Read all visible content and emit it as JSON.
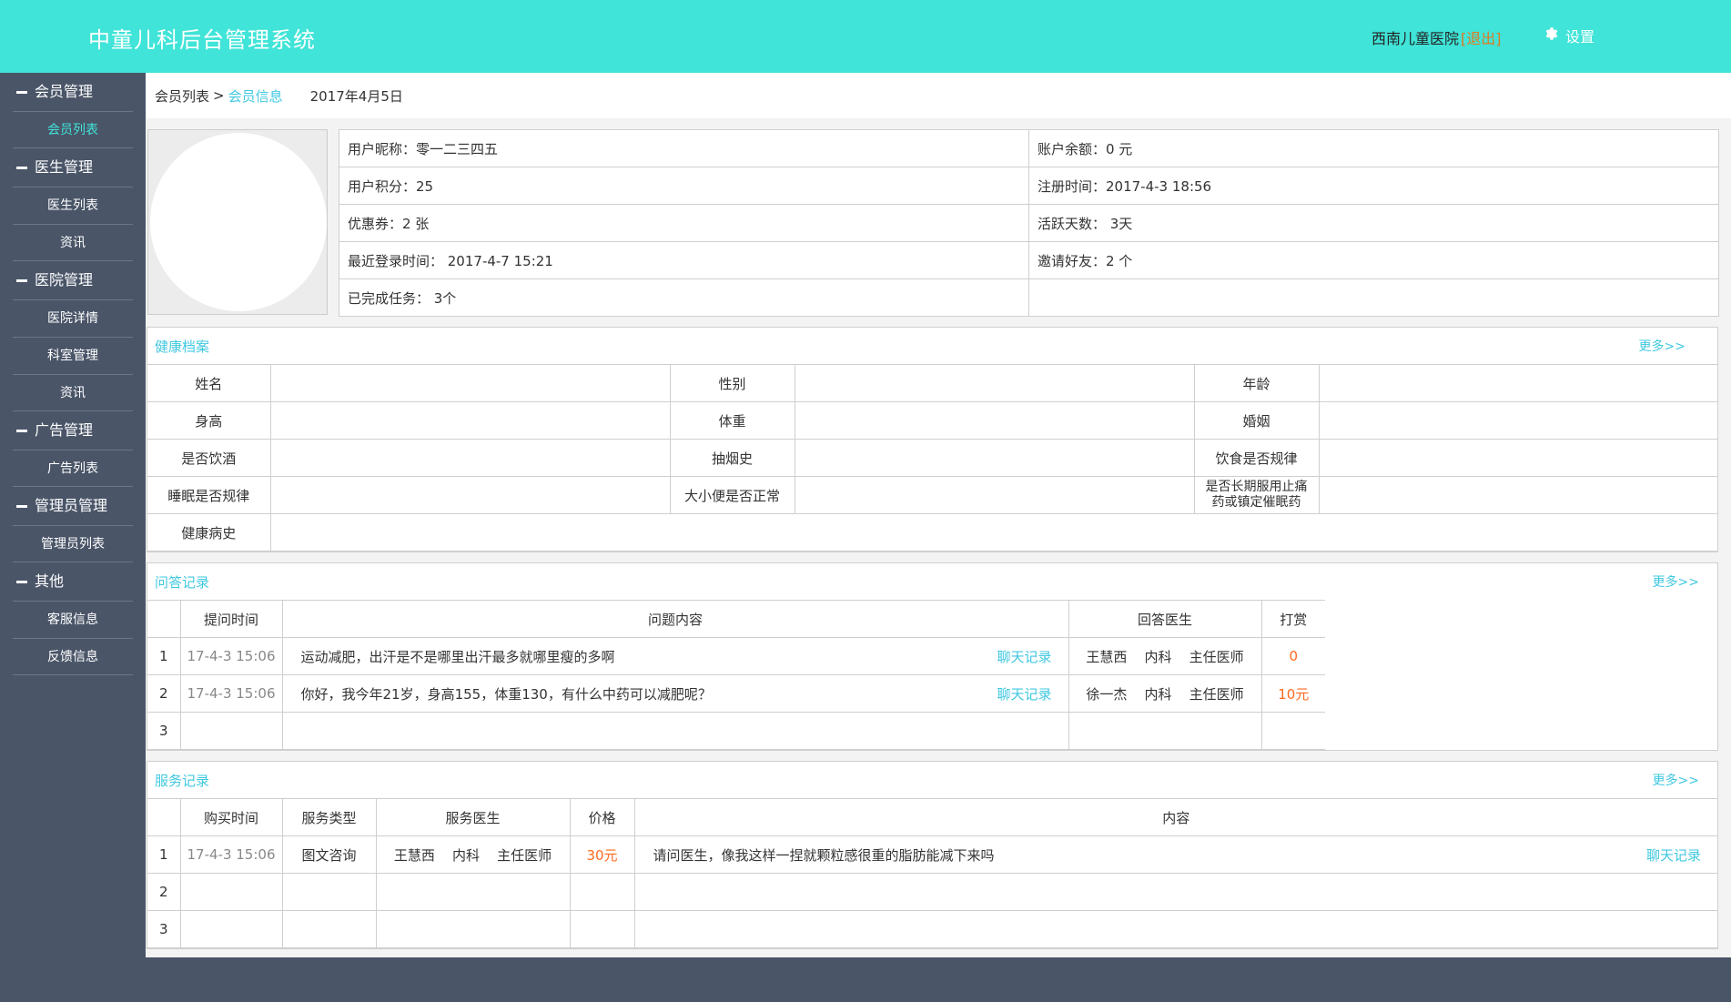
{
  "header": {
    "title": "中童儿科后台管理系统",
    "hospital": "西南儿童医院",
    "logout": "[退出]",
    "settings": "设置",
    "bg_color": "#40e4d8"
  },
  "sidebar": {
    "groups": [
      {
        "label": "会员管理",
        "items": [
          "会员列表"
        ]
      },
      {
        "label": "医生管理",
        "items": [
          "医生列表",
          "资讯"
        ]
      },
      {
        "label": "医院管理",
        "items": [
          "医院详情",
          "科室管理",
          "资讯"
        ]
      },
      {
        "label": "广告管理",
        "items": [
          "广告列表"
        ]
      },
      {
        "label": "管理员管理",
        "items": [
          "管理员列表"
        ]
      },
      {
        "label": "其他",
        "items": [
          "客服信息",
          "反馈信息"
        ]
      }
    ]
  },
  "breadcrumb": {
    "parent": "会员列表",
    "sep": ">",
    "current": "会员信息",
    "date": "2017年4月5日"
  },
  "profile": {
    "nickname": "用户昵称：零一二三四五",
    "balance": "账户余额：0 元",
    "points": "用户积分：25",
    "registered": "注册时间：2017-4-3   18:56",
    "coupons": "优惠券：2 张",
    "active_days": "活跃天数：  3天",
    "last_login": "最近登录时间：  2017-4-7   15:21",
    "invites": "邀请好友：2 个",
    "tasks": "已完成任务：  3个"
  },
  "health": {
    "title": "健康档案",
    "more": "更多>>",
    "labels": {
      "name": "姓名",
      "gender": "性别",
      "age": "年龄",
      "height": "身高",
      "weight": "体重",
      "marriage": "婚姻",
      "drink": "是否饮酒",
      "smoke": "抽烟史",
      "diet": "饮食是否规律",
      "sleep": "睡眠是否规律",
      "bowel": "大小便是否正常",
      "drug_line1": "是否长期服用止痛",
      "drug_line2": "药或镇定催眠药",
      "history": "健康病史"
    }
  },
  "qa": {
    "title": "问答记录",
    "more": "更多>>",
    "headers": {
      "time": "提问时间",
      "content": "问题内容",
      "doctor": "回答医生",
      "reward": "打赏"
    },
    "rows": [
      {
        "no": "1",
        "time": "17-4-3  15:06",
        "content": "运动减肥，出汗是不是哪里出汗最多就哪里瘦的多啊",
        "chat": "聊天记录",
        "doctor": "王慧西    内科    主任医师",
        "reward": "0"
      },
      {
        "no": "2",
        "time": "17-4-3  15:06",
        "content": "你好，我今年21岁，身高155，体重130，有什么中药可以减肥呢？",
        "chat": "聊天记录",
        "doctor": "徐一杰    内科    主任医师",
        "reward": "10元"
      },
      {
        "no": "3",
        "time": "",
        "content": "",
        "chat": "",
        "doctor": "",
        "reward": ""
      }
    ]
  },
  "services": {
    "title": "服务记录",
    "more": "更多>>",
    "headers": {
      "time": "购买时间",
      "type": "服务类型",
      "doctor": "服务医生",
      "price": "价格",
      "content": "内容"
    },
    "rows": [
      {
        "no": "1",
        "time": "17-4-3  15:06",
        "type": "图文咨询",
        "doctor": "王慧西    内科    主任医师",
        "price": "30元",
        "content": "请问医生，像我这样一捏就颗粒感很重的脂肪能减下来吗",
        "chat": "聊天记录"
      },
      {
        "no": "2",
        "time": "",
        "type": "",
        "doctor": "",
        "price": "",
        "content": "",
        "chat": ""
      },
      {
        "no": "3",
        "time": "",
        "type": "",
        "doctor": "",
        "price": "",
        "content": "",
        "chat": ""
      }
    ]
  }
}
